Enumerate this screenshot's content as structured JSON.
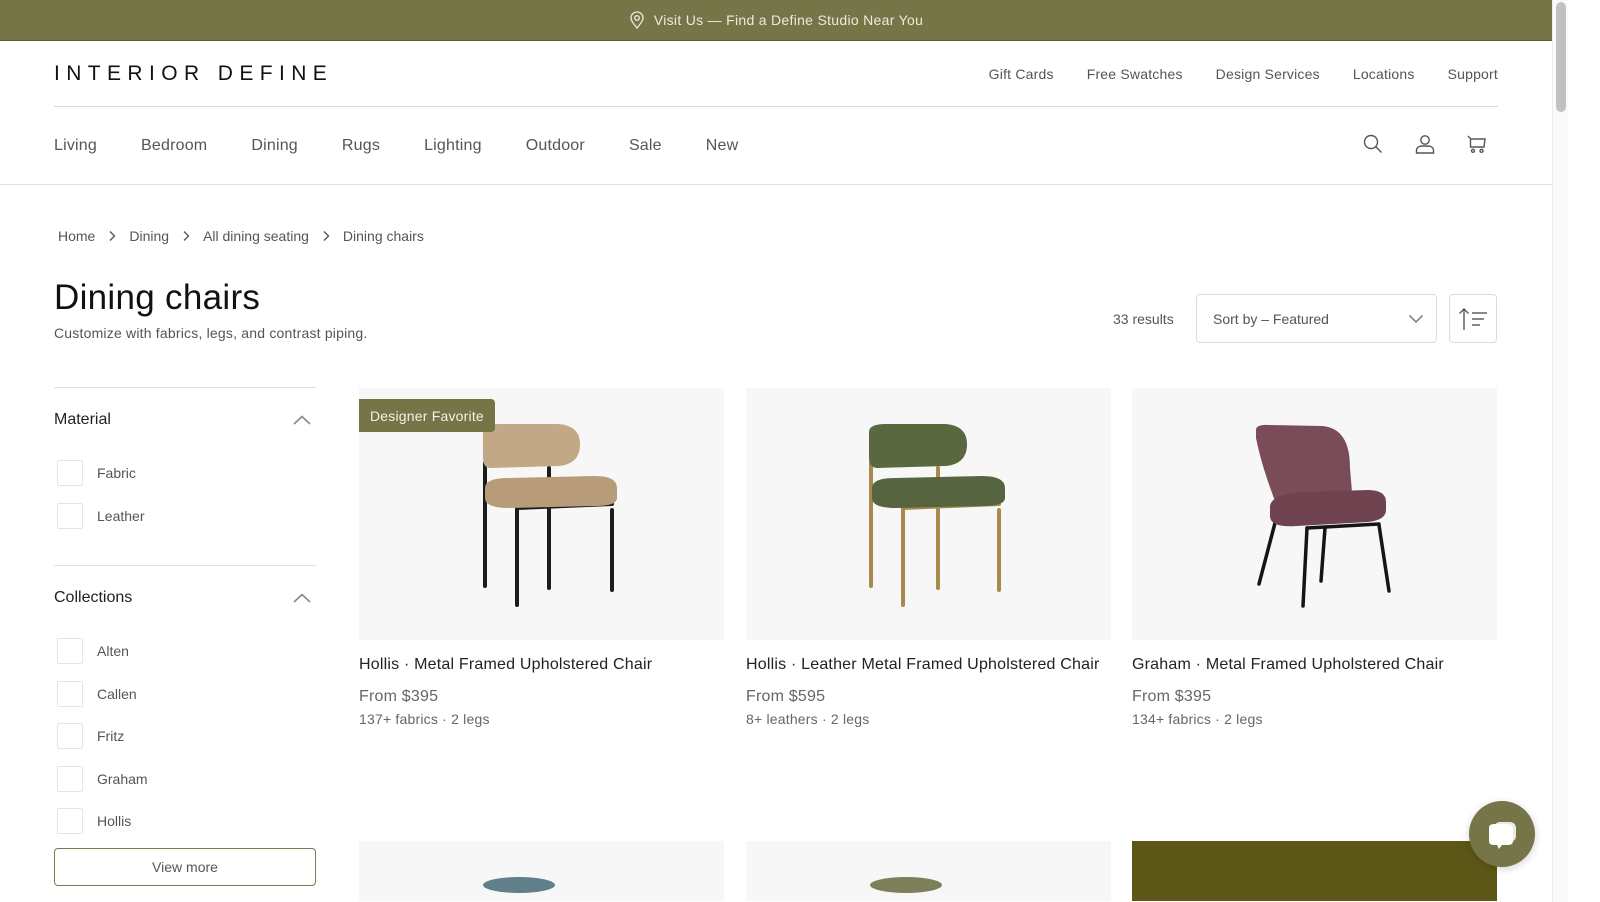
{
  "promo": {
    "icon": "map-pin-icon",
    "text": "Visit Us — Find a Define Studio Near You"
  },
  "header": {
    "logo": "INTERIOR DEFINE",
    "utility_links": [
      "Gift Cards",
      "Free Swatches",
      "Design Services",
      "Locations",
      "Support"
    ],
    "nav": [
      "Living",
      "Bedroom",
      "Dining",
      "Rugs",
      "Lighting",
      "Outdoor",
      "Sale",
      "New"
    ],
    "icons": [
      "search-icon",
      "account-icon",
      "cart-icon"
    ]
  },
  "breadcrumb": [
    "Home",
    "Dining",
    "All dining seating",
    "Dining chairs"
  ],
  "page": {
    "title": "Dining chairs",
    "subtitle": "Customize with fabrics, legs, and contrast piping.",
    "results": "33 results",
    "sort": {
      "label": "Sort by – Featured"
    }
  },
  "filters": [
    {
      "title": "Material",
      "expanded": true,
      "options": [
        "Fabric",
        "Leather"
      ]
    },
    {
      "title": "Collections",
      "expanded": true,
      "options": [
        "Alten",
        "Callen",
        "Fritz",
        "Graham",
        "Hollis"
      ],
      "view_more": "View more"
    }
  ],
  "products": [
    {
      "badge": "Designer Favorite",
      "name": "Hollis · Metal Framed Upholstered Chair",
      "price": "From $395",
      "meta": "137+ fabrics · 2 legs",
      "colors": {
        "upholstery": "#c2a887",
        "legs": "#1c1c1c"
      }
    },
    {
      "badge": null,
      "name": "Hollis · Leather Metal Framed Upholstered Chair",
      "price": "From $595",
      "meta": "8+ leathers · 2 legs",
      "colors": {
        "upholstery": "#5a6840",
        "legs": "#a88a4f"
      }
    },
    {
      "badge": null,
      "name": "Graham · Metal Framed Upholstered Chair",
      "price": "From $395",
      "meta": "134+ fabrics · 2 legs",
      "colors": {
        "upholstery": "#7a4c57",
        "legs": "#151515"
      }
    }
  ],
  "colors": {
    "brand": "#767547",
    "text": "#222222",
    "muted": "#555555"
  },
  "chat": {
    "icon": "chat-icon"
  }
}
